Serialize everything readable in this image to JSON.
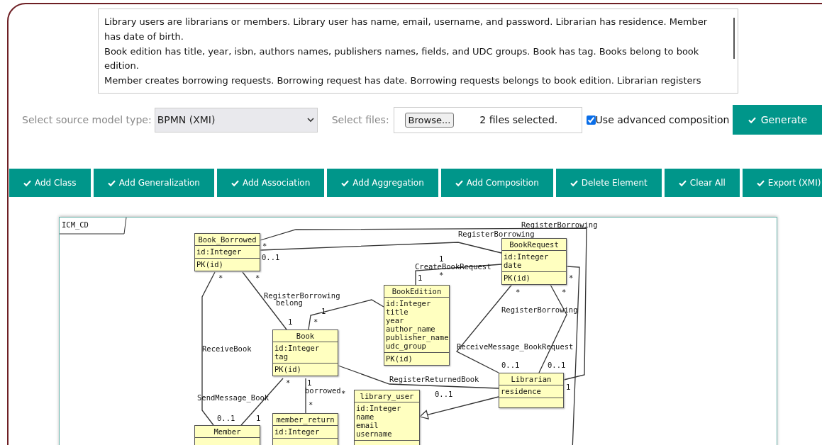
{
  "requirements": {
    "value": "Library users are librarians or members. Library user has name, email, username, and password. Librarian has residence. Member has date of birth.\nBook edition has title, year, isbn, authors names, publishers names, fields, and UDC groups. Book has tag. Books belong to book edition.\nMember creates borrowing requests. Borrowing request has date. Borrowing requests belongs to book edition. Librarian registers"
  },
  "source_model": {
    "label": "Select source model type:",
    "value": "BPMN (XMI)"
  },
  "files": {
    "label": "Select files:",
    "button": "Browse...",
    "status": "2 files selected."
  },
  "advanced_composition": {
    "label": "Use advanced composition",
    "checked": true
  },
  "generate_button": "Generate",
  "toolbar": [
    "Add Class",
    "Add Generalization",
    "Add Association",
    "Add Aggregation",
    "Add Composition",
    "Delete Element",
    "Clear All",
    "Export (XMI)"
  ],
  "diagram": {
    "title": "ICM_CD",
    "classes": [
      {
        "name": "Book_Borrowed",
        "attributes": [
          "id:Integer"
        ],
        "operations": [
          "PK(id)"
        ]
      },
      {
        "name": "BookRequest",
        "attributes": [
          "id:Integer",
          "date"
        ],
        "operations": [
          "PK(id)"
        ]
      },
      {
        "name": "BookEdition",
        "attributes": [
          "id:Integer",
          "title",
          "year",
          "author_name",
          "publisher_name",
          "udc_group"
        ],
        "operations": [
          "PK(id)"
        ]
      },
      {
        "name": "Book",
        "attributes": [
          "id:Integer",
          "tag"
        ],
        "operations": [
          "PK(id)"
        ]
      },
      {
        "name": "Librarian",
        "attributes": [
          "residence"
        ]
      },
      {
        "name": "Member"
      },
      {
        "name": "member_return",
        "attributes": [
          "id:Integer"
        ]
      },
      {
        "name": "library_user",
        "attributes": [
          "id:Integer",
          "name",
          "email",
          "username"
        ]
      }
    ],
    "connectors": [
      {
        "kind": "association"
      },
      {
        "kind": "association"
      },
      {
        "kind": "association"
      },
      {
        "kind": "association"
      },
      {
        "kind": "association"
      },
      {
        "kind": "association"
      },
      {
        "kind": "association"
      },
      {
        "kind": "association"
      },
      {
        "kind": "association"
      },
      {
        "kind": "association"
      },
      {
        "kind": "association"
      },
      {
        "kind": "association"
      },
      {
        "kind": "generalization"
      }
    ],
    "edge_labels": [
      "RegisterBorrowing",
      "RegisterBorrowing",
      "CreateBookRequest",
      "RegisterBorrowing",
      "belong",
      "ReceiveBook",
      "SendMessage_Book",
      "RegisterBorrowing",
      "ReceiveMessage_BookRequest",
      "RegisterReturnedBook",
      "borrowed"
    ],
    "multiplicities": [
      "*",
      "0..1",
      "*",
      "*",
      "1",
      "*",
      "1",
      "1",
      "1",
      "*",
      "*",
      "*",
      "*",
      "0..1",
      "0..1",
      "1",
      "0..1",
      "*",
      "1",
      "*",
      "*",
      "0..1",
      "1"
    ]
  }
}
